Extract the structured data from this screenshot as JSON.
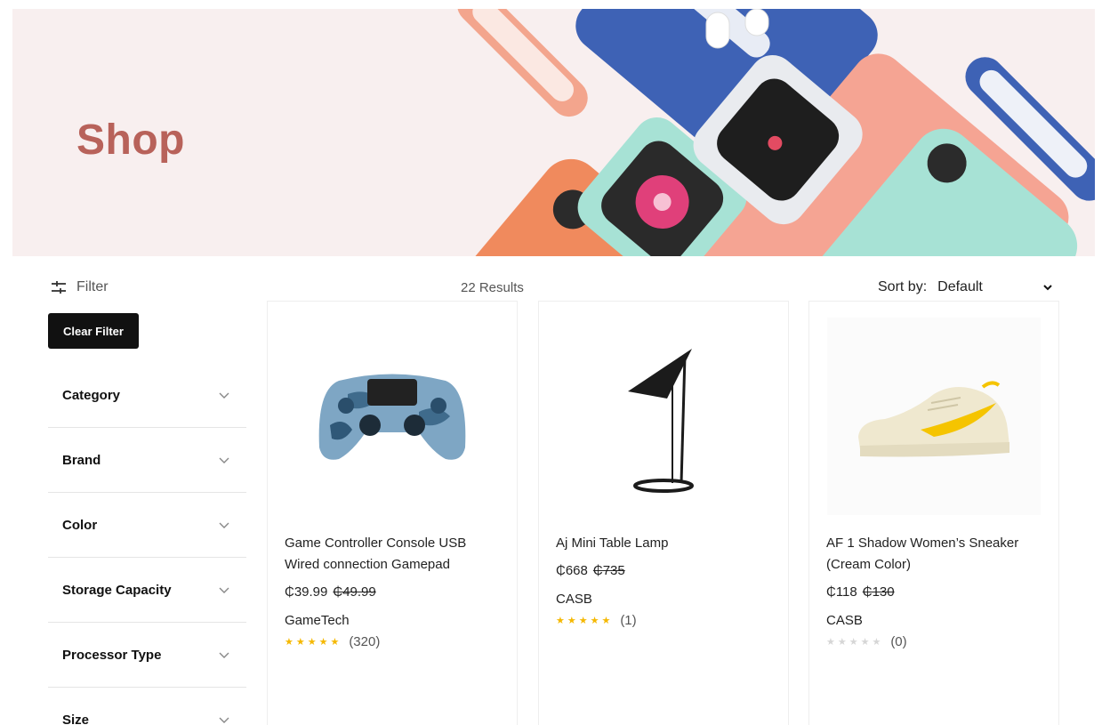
{
  "hero": {
    "title": "Shop"
  },
  "toolbar": {
    "filter_label": "Filter",
    "results": "22 Results",
    "sort_label": "Sort by:",
    "sort_value": "Default"
  },
  "sidebar": {
    "clear_label": "Clear Filter",
    "facets": [
      {
        "label": "Category"
      },
      {
        "label": "Brand"
      },
      {
        "label": "Color"
      },
      {
        "label": "Storage Capacity"
      },
      {
        "label": "Processor Type"
      },
      {
        "label": "Size"
      }
    ]
  },
  "products": [
    {
      "name": "Game Controller Console USB Wired connection Gamepad",
      "price": "₵39.99",
      "old_price": "₵49.99",
      "brand": "GameTech",
      "stars": "★★★★★",
      "rating_count": "(320)",
      "rating": 5
    },
    {
      "name": "Aj Mini Table Lamp",
      "price": "₵668",
      "old_price": "₵735",
      "brand": "CASB",
      "stars": "★★★★★",
      "rating_count": "(1)",
      "rating": 5
    },
    {
      "name": "AF 1 Shadow Women’s Sneaker (Cream Color)",
      "price": "₵118",
      "old_price": "₵130",
      "brand": "CASB",
      "stars": "★★★★★",
      "rating_count": "(0)",
      "rating": 0
    }
  ],
  "colors": {
    "hero_title": "#b8625a",
    "hero_bg": "#f8efef",
    "star": "#f5b800",
    "button_bg": "#111111"
  },
  "icons": {
    "filter": "sliders-icon",
    "facet_toggle": "chevron-down-icon",
    "sort_toggle": "chevron-down-icon"
  }
}
